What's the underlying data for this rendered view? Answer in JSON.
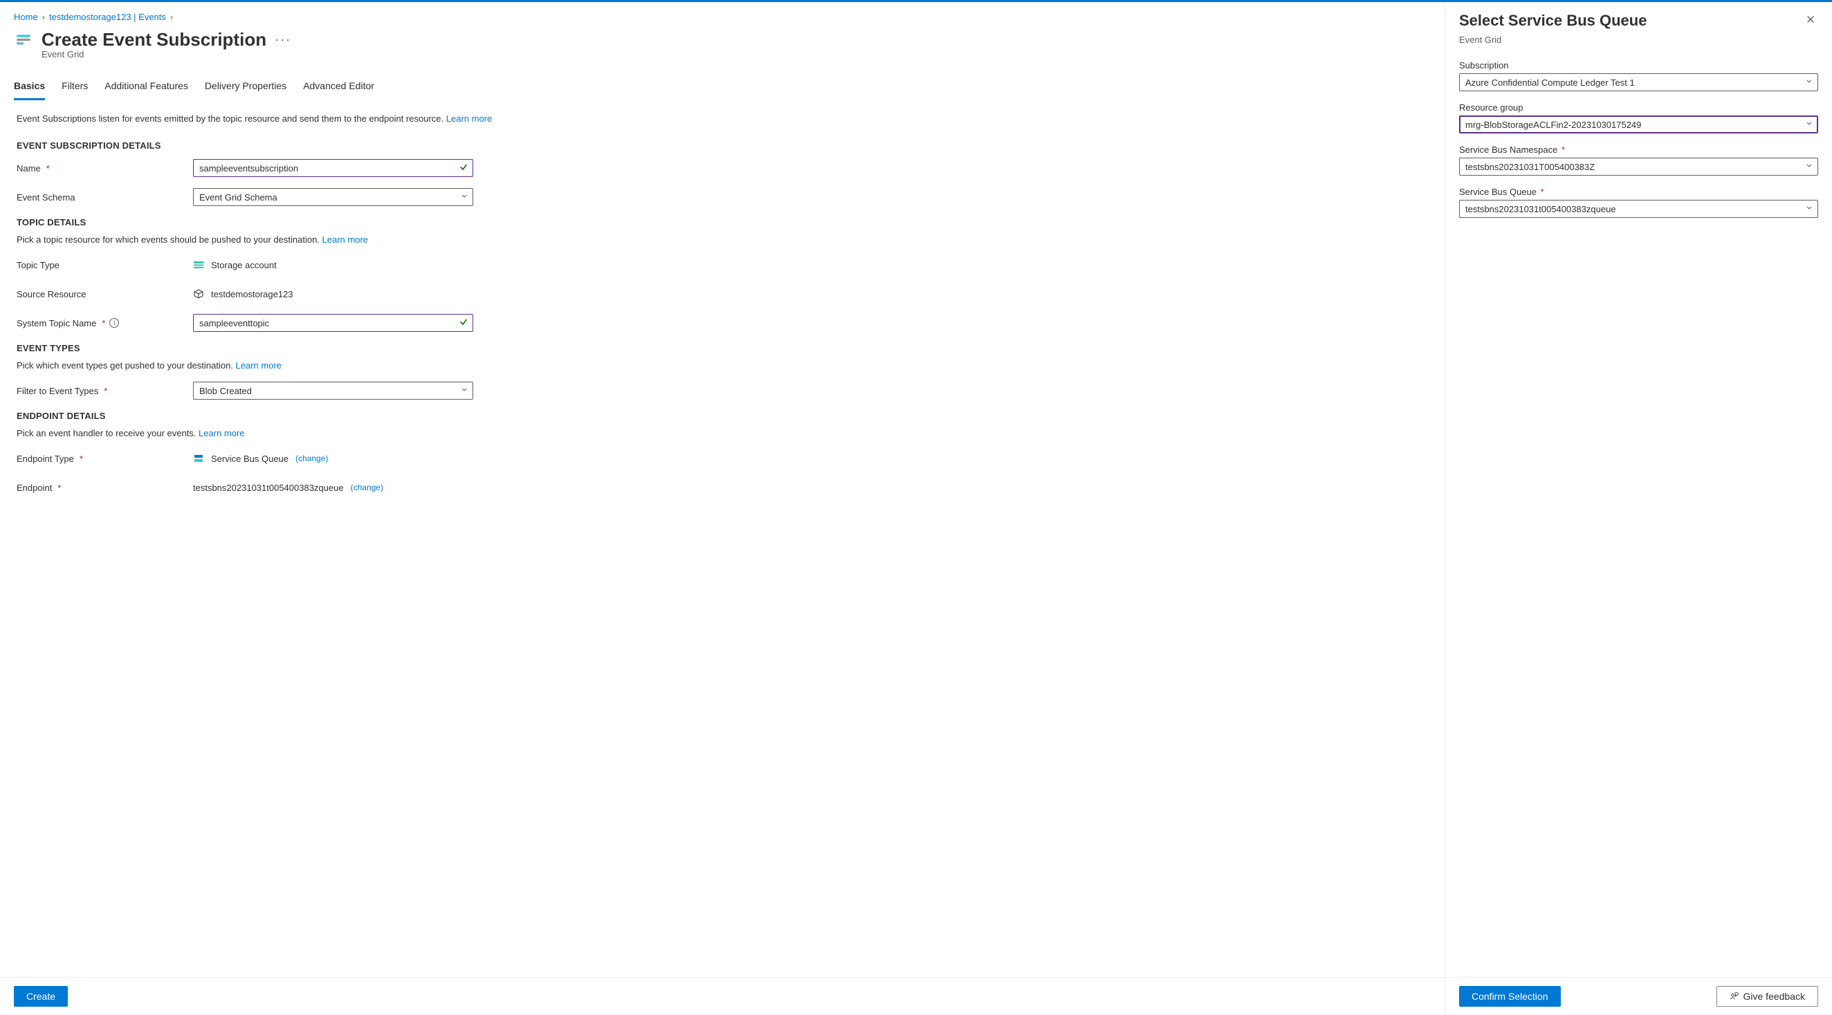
{
  "breadcrumb": {
    "items": [
      "Home",
      "testdemostorage123 | Events"
    ]
  },
  "page": {
    "title": "Create Event Subscription",
    "subtitle": "Event Grid",
    "intro_prefix": "Event Subscriptions listen for events emitted by the topic resource and send them to the endpoint resource. ",
    "learn_more": "Learn more"
  },
  "tabs": [
    "Basics",
    "Filters",
    "Additional Features",
    "Delivery Properties",
    "Advanced Editor"
  ],
  "active_tab": 0,
  "sections": {
    "details": {
      "title": "EVENT SUBSCRIPTION DETAILS",
      "name_label": "Name",
      "name_value": "sampleeventsubscription",
      "schema_label": "Event Schema",
      "schema_value": "Event Grid Schema"
    },
    "topic": {
      "title": "TOPIC DETAILS",
      "desc": "Pick a topic resource for which events should be pushed to your destination. ",
      "type_label": "Topic Type",
      "type_value": "Storage account",
      "source_label": "Source Resource",
      "source_value": "testdemostorage123",
      "system_label": "System Topic Name",
      "system_value": "sampleeventtopic"
    },
    "eventtypes": {
      "title": "EVENT TYPES",
      "desc": "Pick which event types get pushed to your destination. ",
      "filter_label": "Filter to Event Types",
      "filter_value": "Blob Created"
    },
    "endpoint": {
      "title": "ENDPOINT DETAILS",
      "desc": "Pick an event handler to receive your events. ",
      "type_label": "Endpoint Type",
      "type_value": "Service Bus Queue",
      "change": "(change)",
      "endpoint_label": "Endpoint",
      "endpoint_value": "testsbns20231031t005400383zqueue"
    }
  },
  "footer": {
    "create": "Create",
    "confirm": "Confirm Selection",
    "feedback": "Give feedback"
  },
  "side": {
    "title": "Select Service Bus Queue",
    "subtitle": "Event Grid",
    "fields": {
      "subscription": {
        "label": "Subscription",
        "value": "Azure Confidential Compute Ledger Test 1"
      },
      "rg": {
        "label": "Resource group",
        "value": "mrg-BlobStorageACLFin2-20231030175249"
      },
      "ns": {
        "label": "Service Bus Namespace",
        "value": "testsbns20231031T005400383Z"
      },
      "queue": {
        "label": "Service Bus Queue",
        "value": "testsbns20231031t005400383zqueue"
      }
    }
  }
}
